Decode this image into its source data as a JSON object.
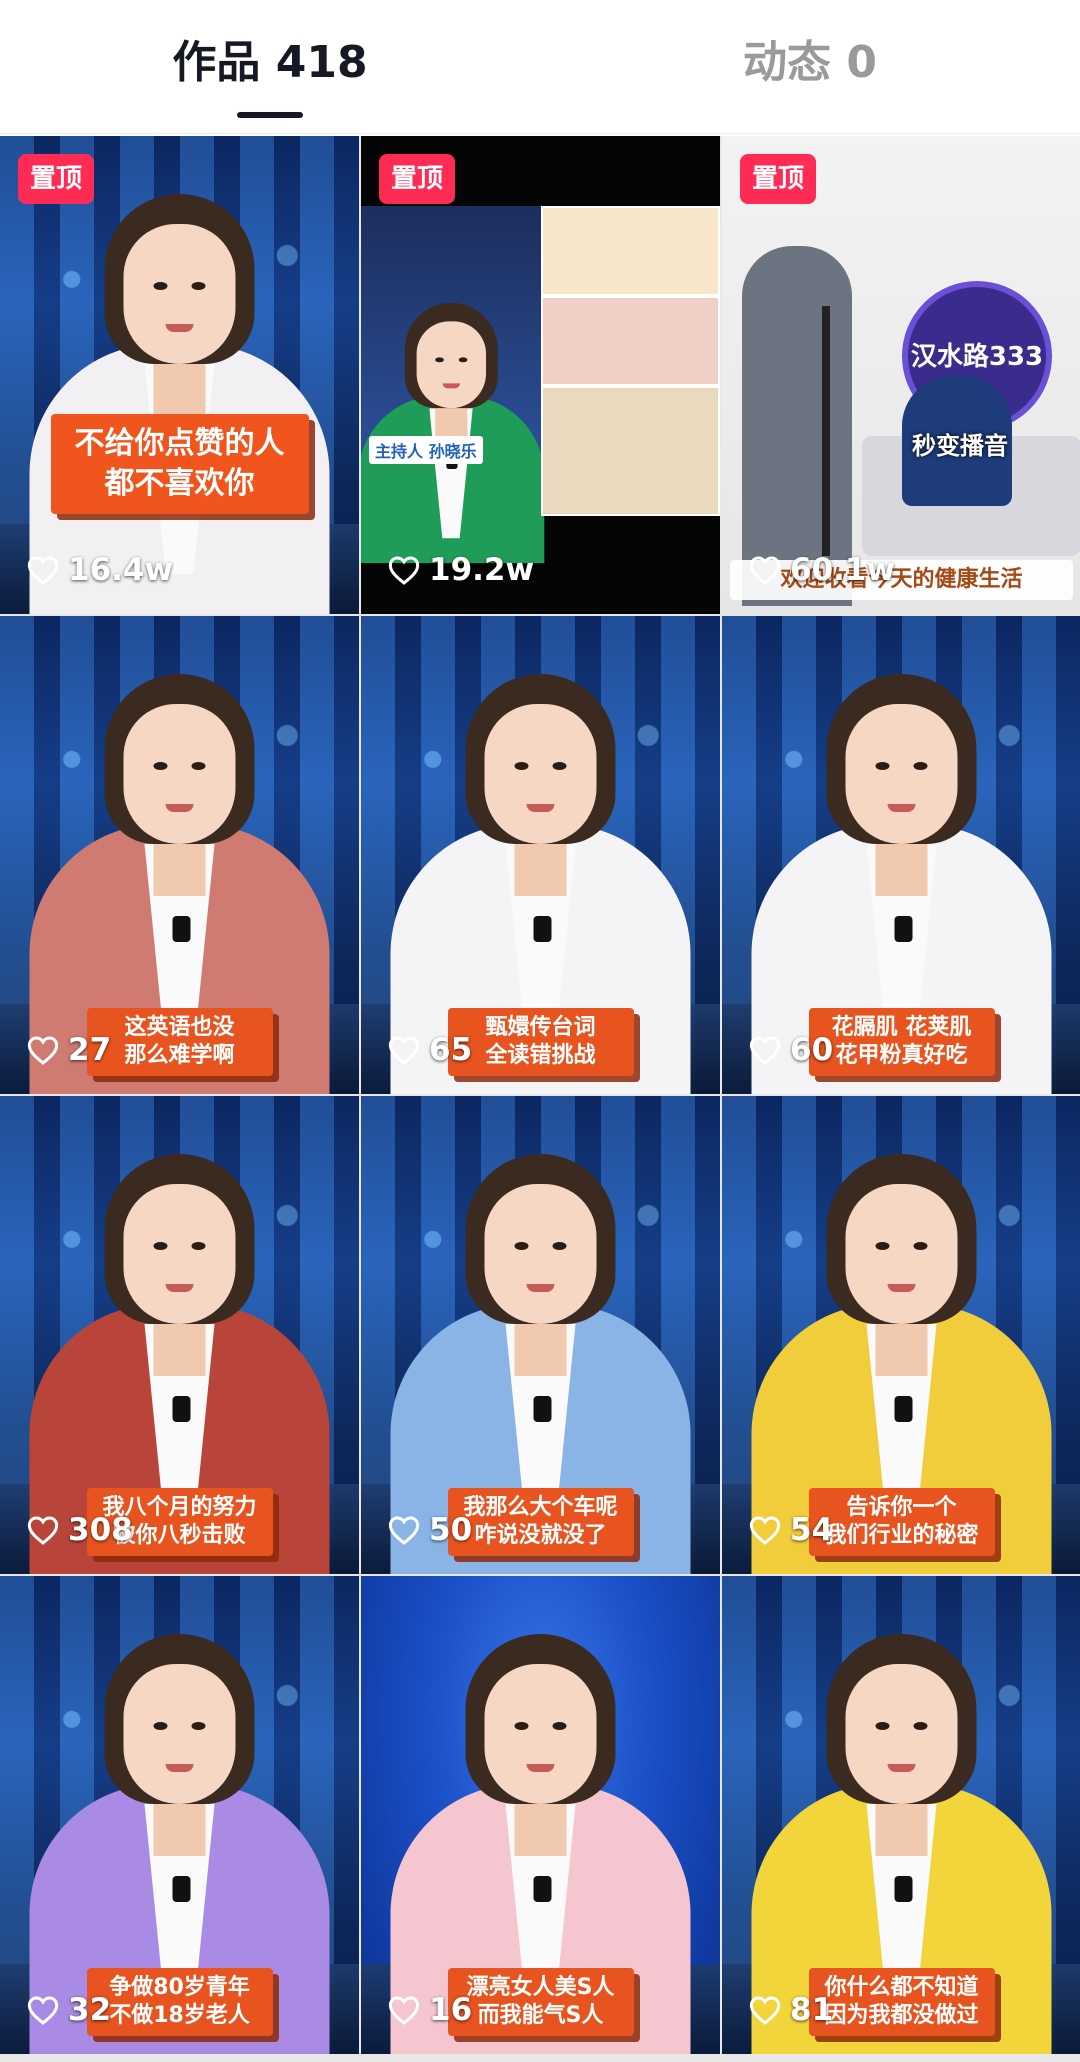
{
  "tabs": [
    {
      "label": "作品 418",
      "active": true
    },
    {
      "label": "动态 0",
      "active": false
    }
  ],
  "pin_label": "置顶",
  "accent_color": "#fe2c55",
  "videos": [
    {
      "likes": "16.4w",
      "pinned": true,
      "caption": "不给你点赞的人\n都不喜欢你",
      "style": "big",
      "jacket": "#f2f0f2"
    },
    {
      "likes": "19.2w",
      "pinned": true,
      "caption": "",
      "style": "collage",
      "jacket": "#1f9c57"
    },
    {
      "likes": "60.1w",
      "pinned": true,
      "caption": "",
      "style": "room",
      "jacket": "#1e3c7b"
    },
    {
      "likes": "27",
      "pinned": false,
      "caption": "这英语也没\n那么难学啊",
      "style": "small",
      "jacket": "#cf7b72"
    },
    {
      "likes": "65",
      "pinned": false,
      "caption": "甄嬛传台词\n全读错挑战",
      "style": "small",
      "jacket": "#f4f4f6"
    },
    {
      "likes": "60",
      "pinned": false,
      "caption": "花膈肌 花荚肌\n花甲粉真好吃",
      "style": "small",
      "jacket": "#f4f4f6"
    },
    {
      "likes": "308",
      "pinned": false,
      "caption": "我八个月的努力\n被你八秒击败",
      "style": "small",
      "jacket": "#b9453a"
    },
    {
      "likes": "50",
      "pinned": false,
      "caption": "我那么大个车呢\n咋说没就没了",
      "style": "small",
      "jacket": "#8ab3e6"
    },
    {
      "likes": "54",
      "pinned": false,
      "caption": "告诉你一个\n我们行业的秘密",
      "style": "small",
      "jacket": "#f2cd3b"
    },
    {
      "likes": "32",
      "pinned": false,
      "caption": "争做80岁青年\n不做18岁老人",
      "style": "small",
      "jacket": "#a98be6"
    },
    {
      "likes": "16",
      "pinned": false,
      "caption": "漂亮女人美S人\n而我能气S人",
      "style": "small",
      "jacket": "#f5c6cf"
    },
    {
      "likes": "81",
      "pinned": false,
      "caption": "你什么都不知道\n因为我都没做过",
      "style": "small",
      "jacket": "#f2d43b"
    }
  ],
  "collage_texts": {
    "host_tag": "主持人 孙晓乐",
    "banner": "欢迎收看今天的健康生活",
    "sign": "汉水路333",
    "speech": "秒变播音"
  }
}
